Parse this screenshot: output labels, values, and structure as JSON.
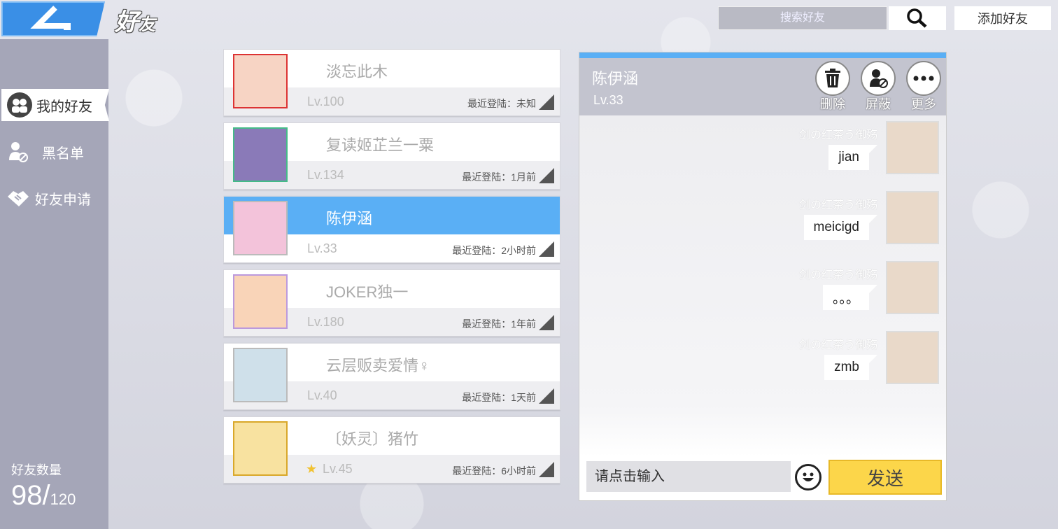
{
  "header": {
    "title": "好",
    "title_small": "友",
    "search_placeholder": "搜索好友",
    "add_friend_label": "添加好友"
  },
  "sidebar": {
    "items": [
      {
        "label": "我的好友",
        "icon": "friends-icon"
      },
      {
        "label": "黑名单",
        "icon": "block-user-icon"
      },
      {
        "label": "好友申请",
        "icon": "handshake-icon"
      }
    ],
    "count_label": "好友数量",
    "count_current": "98",
    "count_sep": "/",
    "count_max": "120"
  },
  "friends": [
    {
      "name": "淡忘此木",
      "level": "Lv.100",
      "login": "最近登陆：未知"
    },
    {
      "name": "复读姬芷兰一粟",
      "level": "Lv.134",
      "login": "最近登陆：1月前"
    },
    {
      "name": "陈伊涵",
      "level": "Lv.33",
      "login": "最近登陆：2小时前"
    },
    {
      "name": "JOKER独一",
      "level": "Lv.180",
      "login": "最近登陆：1年前"
    },
    {
      "name": "云层贩卖爱情♀",
      "level": "Lv.40",
      "login": "最近登陆：1天前"
    },
    {
      "name": "〔妖灵〕猪竹",
      "level": "Lv.45",
      "login": "最近登陆：6小时前"
    }
  ],
  "chat": {
    "name": "陈伊涵",
    "level": "Lv.33",
    "actions": [
      {
        "label": "删除",
        "icon": "trash-icon"
      },
      {
        "label": "屏蔽",
        "icon": "block-icon"
      },
      {
        "label": "更多",
        "icon": "more-icon"
      }
    ],
    "messages": [
      {
        "sender": "剑の红茶う御殇",
        "text": "jian"
      },
      {
        "sender": "剑の红茶う御殇",
        "text": "meicigd"
      },
      {
        "sender": "剑の红茶う御殇",
        "text": "。。。"
      },
      {
        "sender": "剑の红茶う御殇",
        "text": "zmb"
      }
    ],
    "input_placeholder": "请点击输入",
    "send_label": "发送"
  },
  "colors": {
    "accent": "#5aaff5",
    "send": "#fcd64a",
    "sidebar": "#a5a6b8"
  }
}
